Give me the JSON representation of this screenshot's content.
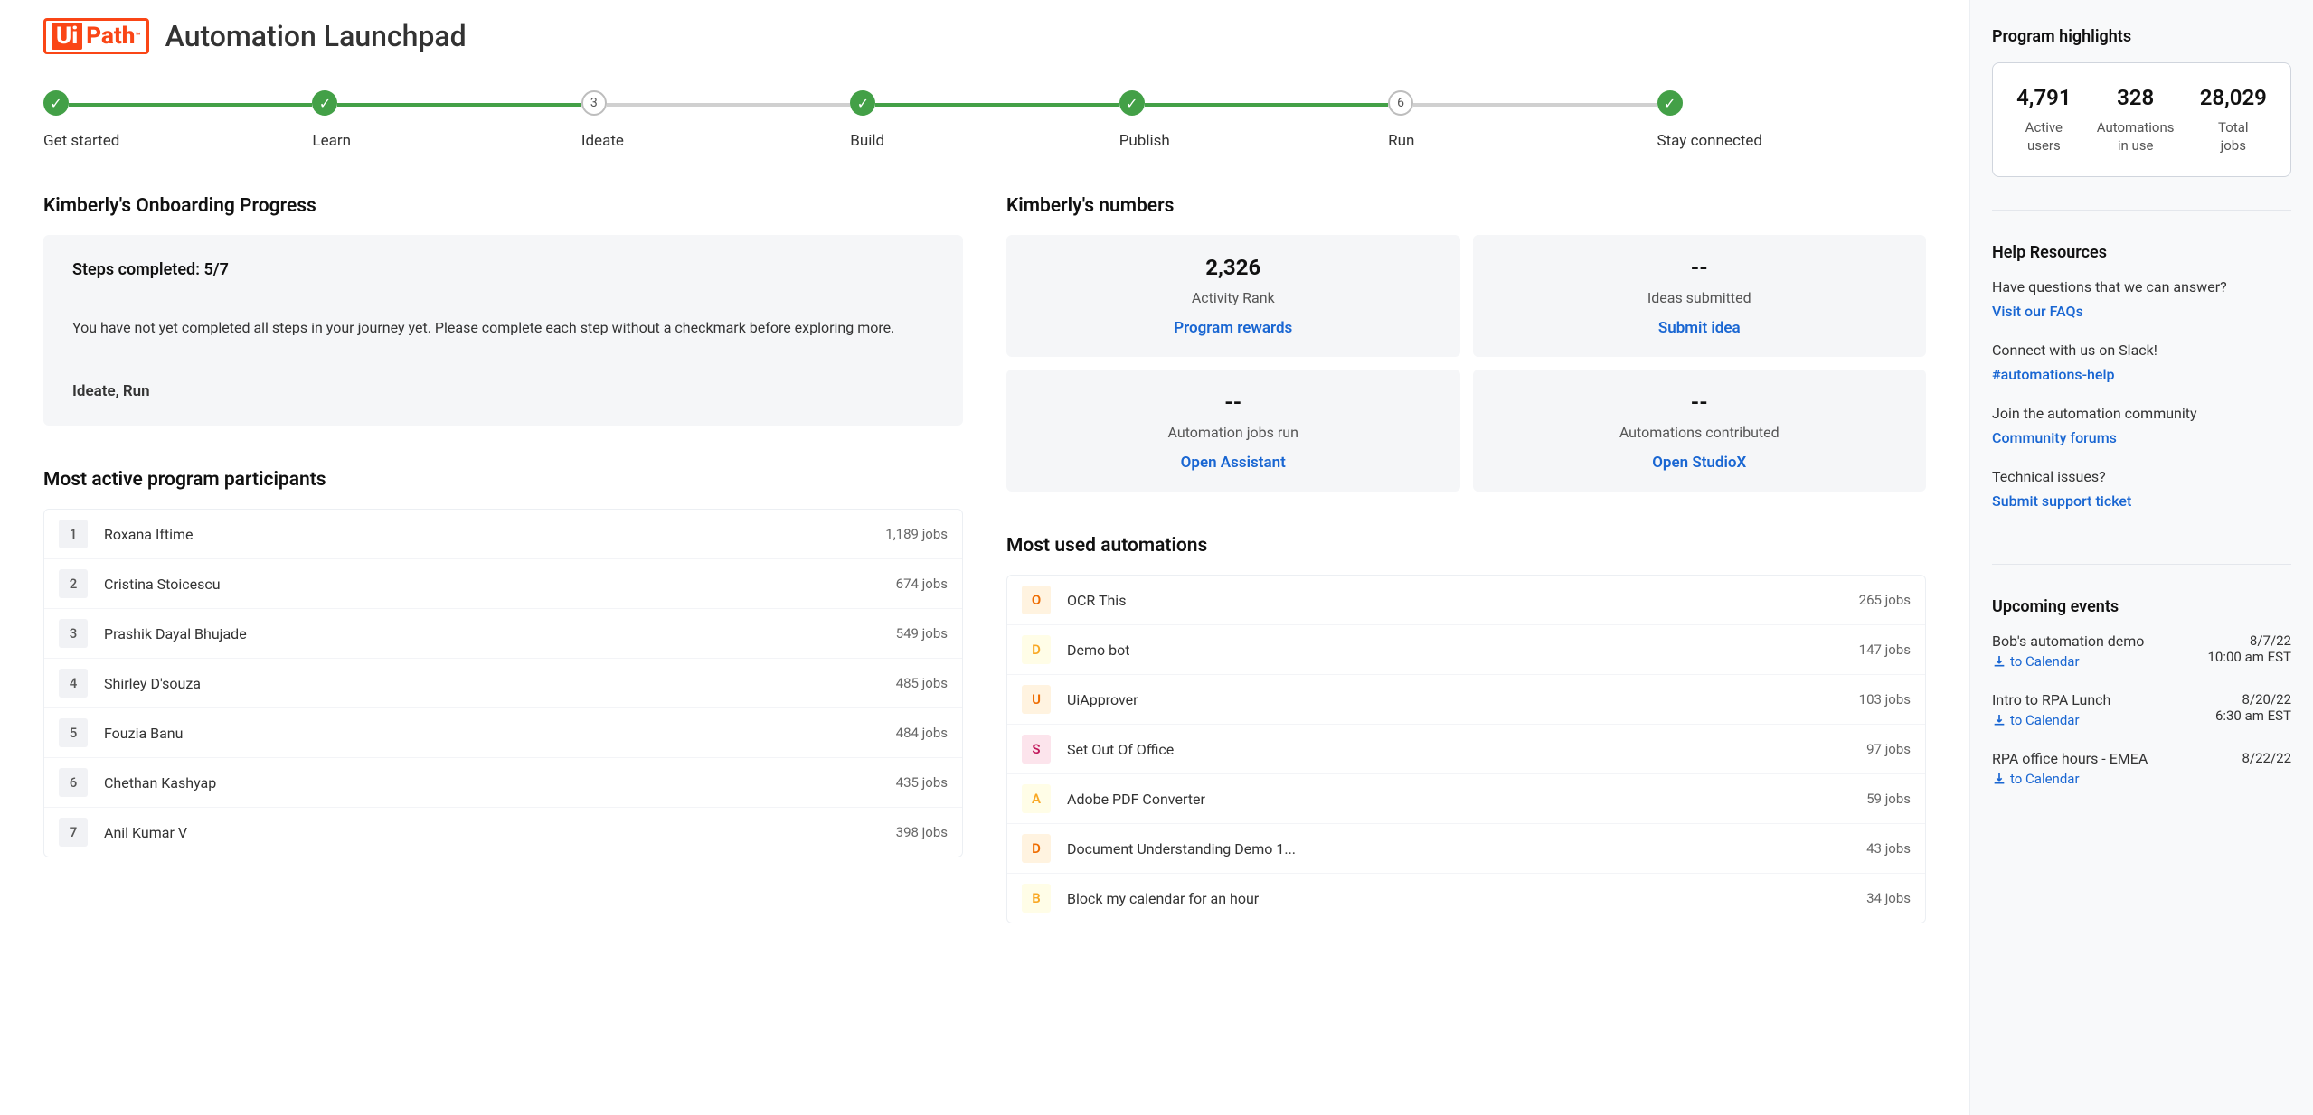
{
  "header": {
    "logo_ui": "Ui",
    "logo_path": "Path",
    "app_title": "Automation Launchpad"
  },
  "stepper": [
    {
      "label": "Get started",
      "state": "complete"
    },
    {
      "label": "Learn",
      "state": "complete"
    },
    {
      "label": "Ideate",
      "state": "pending",
      "num": "3"
    },
    {
      "label": "Build",
      "state": "complete"
    },
    {
      "label": "Publish",
      "state": "complete"
    },
    {
      "label": "Run",
      "state": "pending",
      "num": "6"
    },
    {
      "label": "Stay connected",
      "state": "complete"
    }
  ],
  "onboarding": {
    "title": "Kimberly's Onboarding Progress",
    "steps_label": "Steps completed: 5/7",
    "desc": "You have not yet completed all steps in your journey yet. Please complete each step without a checkmark before exploring more.",
    "missing": "Ideate, Run"
  },
  "numbers": {
    "title": "Kimberly's numbers",
    "stats": [
      {
        "num": "2,326",
        "label": "Activity Rank",
        "link": "Program rewards"
      },
      {
        "num": "--",
        "label": "Ideas submitted",
        "link": "Submit idea"
      },
      {
        "num": "--",
        "label": "Automation jobs run",
        "link": "Open Assistant"
      },
      {
        "num": "--",
        "label": "Automations contributed",
        "link": "Open StudioX"
      }
    ]
  },
  "participants": {
    "title": "Most active program participants",
    "rows": [
      {
        "rank": "1",
        "name": "Roxana Iftime",
        "jobs": "1,189 jobs"
      },
      {
        "rank": "2",
        "name": "Cristina Stoicescu",
        "jobs": "674 jobs"
      },
      {
        "rank": "3",
        "name": "Prashik Dayal Bhujade",
        "jobs": "549 jobs"
      },
      {
        "rank": "4",
        "name": "Shirley D'souza",
        "jobs": "485 jobs"
      },
      {
        "rank": "5",
        "name": "Fouzia Banu",
        "jobs": "484 jobs"
      },
      {
        "rank": "6",
        "name": "Chethan Kashyap",
        "jobs": "435 jobs"
      },
      {
        "rank": "7",
        "name": "Anil Kumar V",
        "jobs": "398 jobs"
      }
    ]
  },
  "automations": {
    "title": "Most used automations",
    "rows": [
      {
        "letter": "O",
        "bg": "#fff3e0",
        "fg": "#ef6c00",
        "name": "OCR This",
        "jobs": "265 jobs"
      },
      {
        "letter": "D",
        "bg": "#fffde7",
        "fg": "#f9a825",
        "name": "Demo bot",
        "jobs": "147 jobs"
      },
      {
        "letter": "U",
        "bg": "#fff3e0",
        "fg": "#ef6c00",
        "name": "UiApprover",
        "jobs": "103 jobs"
      },
      {
        "letter": "S",
        "bg": "#fce4ec",
        "fg": "#c2185b",
        "name": "Set Out Of Office",
        "jobs": "97 jobs"
      },
      {
        "letter": "A",
        "bg": "#fffde7",
        "fg": "#f9a825",
        "name": "Adobe PDF Converter",
        "jobs": "59 jobs"
      },
      {
        "letter": "D",
        "bg": "#fff3e0",
        "fg": "#ef6c00",
        "name": "Document Understanding Demo 1...",
        "jobs": "43 jobs"
      },
      {
        "letter": "B",
        "bg": "#fffde7",
        "fg": "#f9a825",
        "name": "Block my calendar for an hour",
        "jobs": "34 jobs"
      }
    ]
  },
  "highlights": {
    "title": "Program highlights",
    "cells": [
      {
        "n": "4,791",
        "l": "Active users"
      },
      {
        "n": "328",
        "l": "Automations in use"
      },
      {
        "n": "28,029",
        "l": "Total jobs"
      }
    ]
  },
  "help": {
    "title": "Help Resources",
    "items": [
      {
        "q": "Have questions that we can answer?",
        "a": "Visit our FAQs"
      },
      {
        "q": "Connect with us on Slack!",
        "a": "#automations-help"
      },
      {
        "q": "Join the automation community",
        "a": "Community forums"
      },
      {
        "q": "Technical issues?",
        "a": "Submit support ticket"
      }
    ]
  },
  "events": {
    "title": "Upcoming events",
    "cal_label": "to Calendar",
    "items": [
      {
        "name": "Bob's automation demo",
        "date": "8/7/22",
        "time": "10:00 am EST"
      },
      {
        "name": "Intro to RPA Lunch",
        "date": "8/20/22",
        "time": "6:30 am EST"
      },
      {
        "name": "RPA office hours - EMEA",
        "date": "8/22/22",
        "time": ""
      }
    ]
  }
}
